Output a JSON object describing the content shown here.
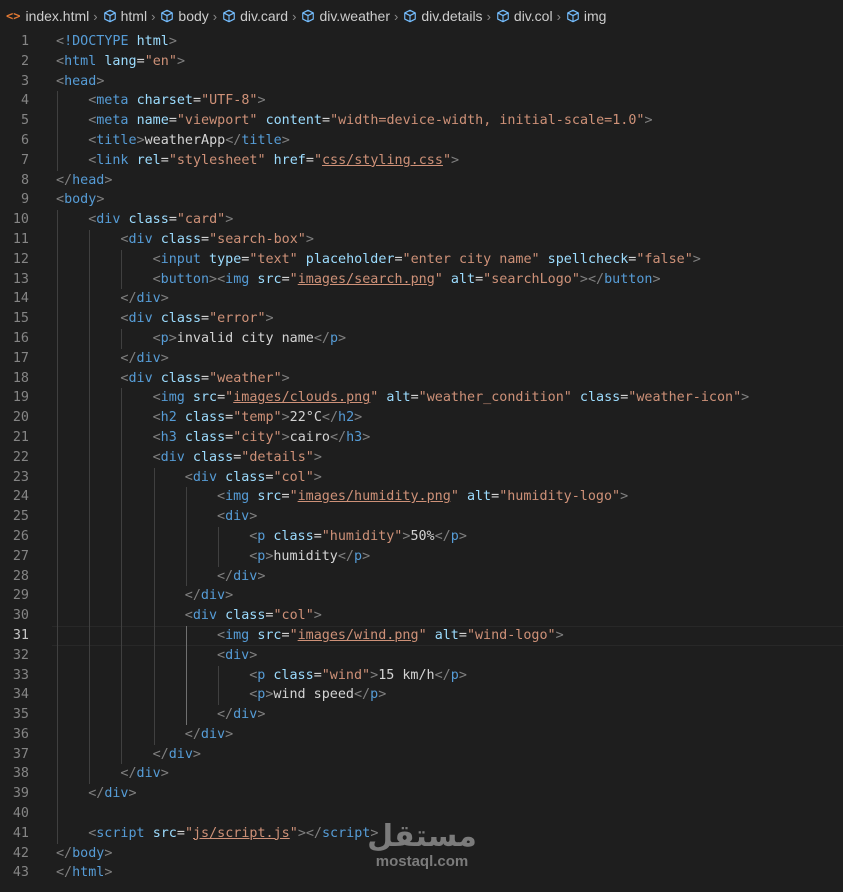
{
  "breadcrumb": [
    {
      "label": "index.html",
      "icon": "html-file-icon"
    },
    {
      "label": "html",
      "icon": "cube-icon"
    },
    {
      "label": "body",
      "icon": "cube-icon"
    },
    {
      "label": "div.card",
      "icon": "cube-icon"
    },
    {
      "label": "div.weather",
      "icon": "cube-icon"
    },
    {
      "label": "div.details",
      "icon": "cube-icon"
    },
    {
      "label": "div.col",
      "icon": "cube-icon"
    },
    {
      "label": "img",
      "icon": "cube-icon"
    }
  ],
  "current_line": 31,
  "colors": {
    "background": "#1e1e1e",
    "punctuation": "#808080",
    "tag": "#569cd6",
    "attribute": "#9cdcfe",
    "string": "#ce9178",
    "text": "#d4d4d4",
    "line_number": "#858585"
  },
  "lines": [
    {
      "indent": 0,
      "tokens": [
        [
          "p",
          "<"
        ],
        [
          "tag",
          "!DOCTYPE"
        ],
        [
          "txt",
          " "
        ],
        [
          "attr",
          "html"
        ],
        [
          "p",
          ">"
        ]
      ]
    },
    {
      "indent": 0,
      "tokens": [
        [
          "p",
          "<"
        ],
        [
          "tag",
          "html"
        ],
        [
          "txt",
          " "
        ],
        [
          "attr",
          "lang"
        ],
        [
          "txt",
          "="
        ],
        [
          "str",
          "\"en\""
        ],
        [
          "p",
          ">"
        ]
      ]
    },
    {
      "indent": 0,
      "tokens": [
        [
          "p",
          "<"
        ],
        [
          "tag",
          "head"
        ],
        [
          "p",
          ">"
        ]
      ]
    },
    {
      "indent": 1,
      "tokens": [
        [
          "p",
          "<"
        ],
        [
          "tag",
          "meta"
        ],
        [
          "txt",
          " "
        ],
        [
          "attr",
          "charset"
        ],
        [
          "txt",
          "="
        ],
        [
          "str",
          "\"UTF-8\""
        ],
        [
          "p",
          ">"
        ]
      ]
    },
    {
      "indent": 1,
      "tokens": [
        [
          "p",
          "<"
        ],
        [
          "tag",
          "meta"
        ],
        [
          "txt",
          " "
        ],
        [
          "attr",
          "name"
        ],
        [
          "txt",
          "="
        ],
        [
          "str",
          "\"viewport\""
        ],
        [
          "txt",
          " "
        ],
        [
          "attr",
          "content"
        ],
        [
          "txt",
          "="
        ],
        [
          "str",
          "\"width=device-width, initial-scale=1.0\""
        ],
        [
          "p",
          ">"
        ]
      ]
    },
    {
      "indent": 1,
      "tokens": [
        [
          "p",
          "<"
        ],
        [
          "tag",
          "title"
        ],
        [
          "p",
          ">"
        ],
        [
          "txt",
          "weatherApp"
        ],
        [
          "p",
          "</"
        ],
        [
          "tag",
          "title"
        ],
        [
          "p",
          ">"
        ]
      ]
    },
    {
      "indent": 1,
      "tokens": [
        [
          "p",
          "<"
        ],
        [
          "tag",
          "link"
        ],
        [
          "txt",
          " "
        ],
        [
          "attr",
          "rel"
        ],
        [
          "txt",
          "="
        ],
        [
          "str",
          "\"stylesheet\""
        ],
        [
          "txt",
          " "
        ],
        [
          "attr",
          "href"
        ],
        [
          "txt",
          "="
        ],
        [
          "str",
          "\""
        ],
        [
          "link",
          "css/styling.css"
        ],
        [
          "str",
          "\""
        ],
        [
          "p",
          ">"
        ]
      ]
    },
    {
      "indent": 0,
      "tokens": [
        [
          "p",
          "</"
        ],
        [
          "tag",
          "head"
        ],
        [
          "p",
          ">"
        ]
      ]
    },
    {
      "indent": 0,
      "tokens": [
        [
          "p",
          "<"
        ],
        [
          "tag",
          "body"
        ],
        [
          "p",
          ">"
        ]
      ]
    },
    {
      "indent": 1,
      "tokens": [
        [
          "p",
          "<"
        ],
        [
          "tag",
          "div"
        ],
        [
          "txt",
          " "
        ],
        [
          "attr",
          "class"
        ],
        [
          "txt",
          "="
        ],
        [
          "str",
          "\"card\""
        ],
        [
          "p",
          ">"
        ]
      ]
    },
    {
      "indent": 2,
      "tokens": [
        [
          "p",
          "<"
        ],
        [
          "tag",
          "div"
        ],
        [
          "txt",
          " "
        ],
        [
          "attr",
          "class"
        ],
        [
          "txt",
          "="
        ],
        [
          "str",
          "\"search-box\""
        ],
        [
          "p",
          ">"
        ]
      ]
    },
    {
      "indent": 3,
      "tokens": [
        [
          "p",
          "<"
        ],
        [
          "tag",
          "input"
        ],
        [
          "txt",
          " "
        ],
        [
          "attr",
          "type"
        ],
        [
          "txt",
          "="
        ],
        [
          "str",
          "\"text\""
        ],
        [
          "txt",
          " "
        ],
        [
          "attr",
          "placeholder"
        ],
        [
          "txt",
          "="
        ],
        [
          "str",
          "\"enter city name\""
        ],
        [
          "txt",
          " "
        ],
        [
          "attr",
          "spellcheck"
        ],
        [
          "txt",
          "="
        ],
        [
          "str",
          "\"false\""
        ],
        [
          "p",
          ">"
        ]
      ]
    },
    {
      "indent": 3,
      "tokens": [
        [
          "p",
          "<"
        ],
        [
          "tag",
          "button"
        ],
        [
          "p",
          "><"
        ],
        [
          "tag",
          "img"
        ],
        [
          "txt",
          " "
        ],
        [
          "attr",
          "src"
        ],
        [
          "txt",
          "="
        ],
        [
          "str",
          "\""
        ],
        [
          "link",
          "images/search.png"
        ],
        [
          "str",
          "\""
        ],
        [
          "txt",
          " "
        ],
        [
          "attr",
          "alt"
        ],
        [
          "txt",
          "="
        ],
        [
          "str",
          "\"searchLogo\""
        ],
        [
          "p",
          "></"
        ],
        [
          "tag",
          "button"
        ],
        [
          "p",
          ">"
        ]
      ]
    },
    {
      "indent": 2,
      "tokens": [
        [
          "p",
          "</"
        ],
        [
          "tag",
          "div"
        ],
        [
          "p",
          ">"
        ]
      ]
    },
    {
      "indent": 2,
      "tokens": [
        [
          "p",
          "<"
        ],
        [
          "tag",
          "div"
        ],
        [
          "txt",
          " "
        ],
        [
          "attr",
          "class"
        ],
        [
          "txt",
          "="
        ],
        [
          "str",
          "\"error\""
        ],
        [
          "p",
          ">"
        ]
      ]
    },
    {
      "indent": 3,
      "tokens": [
        [
          "p",
          "<"
        ],
        [
          "tag",
          "p"
        ],
        [
          "p",
          ">"
        ],
        [
          "txt",
          "invalid city name"
        ],
        [
          "p",
          "</"
        ],
        [
          "tag",
          "p"
        ],
        [
          "p",
          ">"
        ]
      ]
    },
    {
      "indent": 2,
      "tokens": [
        [
          "p",
          "</"
        ],
        [
          "tag",
          "div"
        ],
        [
          "p",
          ">"
        ]
      ]
    },
    {
      "indent": 2,
      "tokens": [
        [
          "p",
          "<"
        ],
        [
          "tag",
          "div"
        ],
        [
          "txt",
          " "
        ],
        [
          "attr",
          "class"
        ],
        [
          "txt",
          "="
        ],
        [
          "str",
          "\"weather\""
        ],
        [
          "p",
          ">"
        ]
      ]
    },
    {
      "indent": 3,
      "tokens": [
        [
          "p",
          "<"
        ],
        [
          "tag",
          "img"
        ],
        [
          "txt",
          " "
        ],
        [
          "attr",
          "src"
        ],
        [
          "txt",
          "="
        ],
        [
          "str",
          "\""
        ],
        [
          "link",
          "images/clouds.png"
        ],
        [
          "str",
          "\""
        ],
        [
          "txt",
          " "
        ],
        [
          "attr",
          "alt"
        ],
        [
          "txt",
          "="
        ],
        [
          "str",
          "\"weather_condition\""
        ],
        [
          "txt",
          " "
        ],
        [
          "attr",
          "class"
        ],
        [
          "txt",
          "="
        ],
        [
          "str",
          "\"weather-icon\""
        ],
        [
          "p",
          ">"
        ]
      ]
    },
    {
      "indent": 3,
      "tokens": [
        [
          "p",
          "<"
        ],
        [
          "tag",
          "h2"
        ],
        [
          "txt",
          " "
        ],
        [
          "attr",
          "class"
        ],
        [
          "txt",
          "="
        ],
        [
          "str",
          "\"temp\""
        ],
        [
          "p",
          ">"
        ],
        [
          "txt",
          "22°C"
        ],
        [
          "p",
          "</"
        ],
        [
          "tag",
          "h2"
        ],
        [
          "p",
          ">"
        ]
      ]
    },
    {
      "indent": 3,
      "tokens": [
        [
          "p",
          "<"
        ],
        [
          "tag",
          "h3"
        ],
        [
          "txt",
          " "
        ],
        [
          "attr",
          "class"
        ],
        [
          "txt",
          "="
        ],
        [
          "str",
          "\"city\""
        ],
        [
          "p",
          ">"
        ],
        [
          "txt",
          "cairo"
        ],
        [
          "p",
          "</"
        ],
        [
          "tag",
          "h3"
        ],
        [
          "p",
          ">"
        ]
      ]
    },
    {
      "indent": 3,
      "tokens": [
        [
          "p",
          "<"
        ],
        [
          "tag",
          "div"
        ],
        [
          "txt",
          " "
        ],
        [
          "attr",
          "class"
        ],
        [
          "txt",
          "="
        ],
        [
          "str",
          "\"details\""
        ],
        [
          "p",
          ">"
        ]
      ]
    },
    {
      "indent": 4,
      "tokens": [
        [
          "p",
          "<"
        ],
        [
          "tag",
          "div"
        ],
        [
          "txt",
          " "
        ],
        [
          "attr",
          "class"
        ],
        [
          "txt",
          "="
        ],
        [
          "str",
          "\"col\""
        ],
        [
          "p",
          ">"
        ]
      ]
    },
    {
      "indent": 5,
      "tokens": [
        [
          "p",
          "<"
        ],
        [
          "tag",
          "img"
        ],
        [
          "txt",
          " "
        ],
        [
          "attr",
          "src"
        ],
        [
          "txt",
          "="
        ],
        [
          "str",
          "\""
        ],
        [
          "link",
          "images/humidity.png"
        ],
        [
          "str",
          "\""
        ],
        [
          "txt",
          " "
        ],
        [
          "attr",
          "alt"
        ],
        [
          "txt",
          "="
        ],
        [
          "str",
          "\"humidity-logo\""
        ],
        [
          "p",
          ">"
        ]
      ]
    },
    {
      "indent": 5,
      "tokens": [
        [
          "p",
          "<"
        ],
        [
          "tag",
          "div"
        ],
        [
          "p",
          ">"
        ]
      ]
    },
    {
      "indent": 6,
      "tokens": [
        [
          "p",
          "<"
        ],
        [
          "tag",
          "p"
        ],
        [
          "txt",
          " "
        ],
        [
          "attr",
          "class"
        ],
        [
          "txt",
          "="
        ],
        [
          "str",
          "\"humidity\""
        ],
        [
          "p",
          ">"
        ],
        [
          "txt",
          "50%"
        ],
        [
          "p",
          "</"
        ],
        [
          "tag",
          "p"
        ],
        [
          "p",
          ">"
        ]
      ]
    },
    {
      "indent": 6,
      "tokens": [
        [
          "p",
          "<"
        ],
        [
          "tag",
          "p"
        ],
        [
          "p",
          ">"
        ],
        [
          "txt",
          "humidity"
        ],
        [
          "p",
          "</"
        ],
        [
          "tag",
          "p"
        ],
        [
          "p",
          ">"
        ]
      ]
    },
    {
      "indent": 5,
      "tokens": [
        [
          "p",
          "</"
        ],
        [
          "tag",
          "div"
        ],
        [
          "p",
          ">"
        ]
      ]
    },
    {
      "indent": 4,
      "tokens": [
        [
          "p",
          "</"
        ],
        [
          "tag",
          "div"
        ],
        [
          "p",
          ">"
        ]
      ]
    },
    {
      "indent": 4,
      "tokens": [
        [
          "p",
          "<"
        ],
        [
          "tag",
          "div"
        ],
        [
          "txt",
          " "
        ],
        [
          "attr",
          "class"
        ],
        [
          "txt",
          "="
        ],
        [
          "str",
          "\"col\""
        ],
        [
          "p",
          ">"
        ]
      ]
    },
    {
      "indent": 5,
      "tokens": [
        [
          "p",
          "<"
        ],
        [
          "tag",
          "img"
        ],
        [
          "txt",
          " "
        ],
        [
          "attr",
          "src"
        ],
        [
          "txt",
          "="
        ],
        [
          "str",
          "\""
        ],
        [
          "link",
          "images/wind.png"
        ],
        [
          "str",
          "\""
        ],
        [
          "txt",
          " "
        ],
        [
          "attr",
          "alt"
        ],
        [
          "txt",
          "="
        ],
        [
          "str",
          "\"wind-logo\""
        ],
        [
          "p",
          ">"
        ]
      ]
    },
    {
      "indent": 5,
      "tokens": [
        [
          "p",
          "<"
        ],
        [
          "tag",
          "div"
        ],
        [
          "p",
          ">"
        ]
      ]
    },
    {
      "indent": 6,
      "tokens": [
        [
          "p",
          "<"
        ],
        [
          "tag",
          "p"
        ],
        [
          "txt",
          " "
        ],
        [
          "attr",
          "class"
        ],
        [
          "txt",
          "="
        ],
        [
          "str",
          "\"wind\""
        ],
        [
          "p",
          ">"
        ],
        [
          "txt",
          "15 km/h"
        ],
        [
          "p",
          "</"
        ],
        [
          "tag",
          "p"
        ],
        [
          "p",
          ">"
        ]
      ]
    },
    {
      "indent": 6,
      "tokens": [
        [
          "p",
          "<"
        ],
        [
          "tag",
          "p"
        ],
        [
          "p",
          ">"
        ],
        [
          "txt",
          "wind speed"
        ],
        [
          "p",
          "</"
        ],
        [
          "tag",
          "p"
        ],
        [
          "p",
          ">"
        ]
      ]
    },
    {
      "indent": 5,
      "tokens": [
        [
          "p",
          "</"
        ],
        [
          "tag",
          "div"
        ],
        [
          "p",
          ">"
        ]
      ]
    },
    {
      "indent": 4,
      "tokens": [
        [
          "p",
          "</"
        ],
        [
          "tag",
          "div"
        ],
        [
          "p",
          ">"
        ]
      ]
    },
    {
      "indent": 3,
      "tokens": [
        [
          "p",
          "</"
        ],
        [
          "tag",
          "div"
        ],
        [
          "p",
          ">"
        ]
      ]
    },
    {
      "indent": 2,
      "tokens": [
        [
          "p",
          "</"
        ],
        [
          "tag",
          "div"
        ],
        [
          "p",
          ">"
        ]
      ]
    },
    {
      "indent": 1,
      "tokens": [
        [
          "p",
          "</"
        ],
        [
          "tag",
          "div"
        ],
        [
          "p",
          ">"
        ]
      ]
    },
    {
      "indent": 1,
      "tokens": []
    },
    {
      "indent": 1,
      "tokens": [
        [
          "p",
          "<"
        ],
        [
          "tag",
          "script"
        ],
        [
          "txt",
          " "
        ],
        [
          "attr",
          "src"
        ],
        [
          "txt",
          "="
        ],
        [
          "str",
          "\""
        ],
        [
          "link",
          "js/script.js"
        ],
        [
          "str",
          "\""
        ],
        [
          "p",
          "></"
        ],
        [
          "tag",
          "script"
        ],
        [
          "p",
          ">"
        ]
      ]
    },
    {
      "indent": 0,
      "tokens": [
        [
          "p",
          "</"
        ],
        [
          "tag",
          "body"
        ],
        [
          "p",
          ">"
        ]
      ]
    },
    {
      "indent": 0,
      "tokens": [
        [
          "p",
          "</"
        ],
        [
          "tag",
          "html"
        ],
        [
          "p",
          ">"
        ]
      ]
    }
  ],
  "watermark": {
    "arabic": "مستقل",
    "latin": "mostaql.com"
  }
}
